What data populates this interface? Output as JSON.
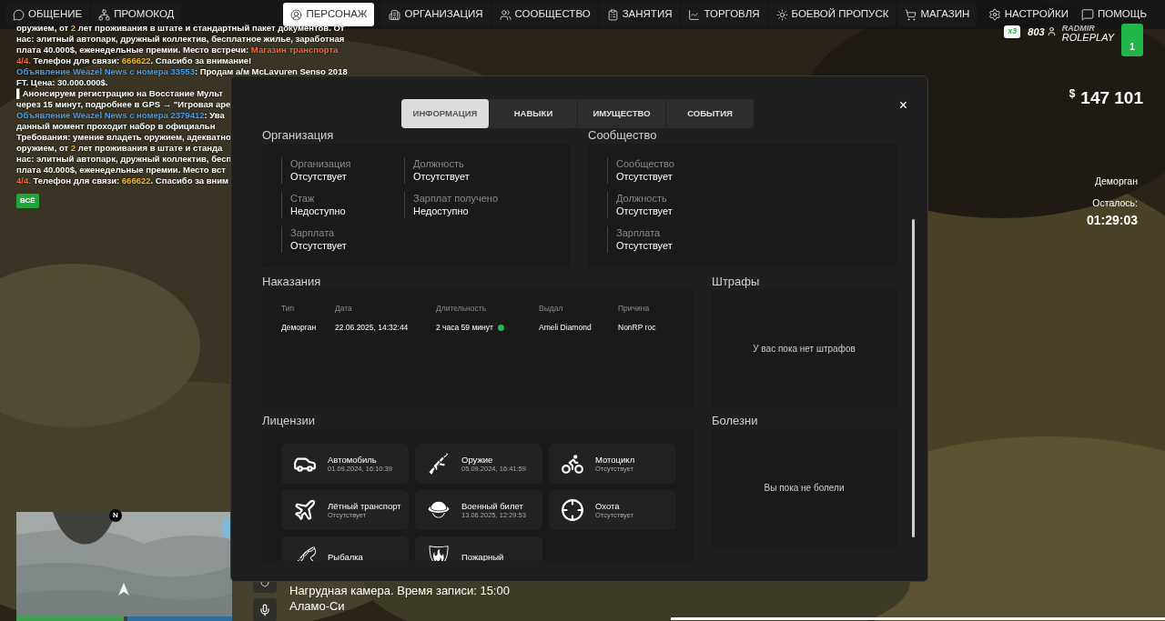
{
  "nav": {
    "left": [
      {
        "label": "ОБЩЕНИЕ",
        "selected": false
      },
      {
        "label": "ПРОМОКОД",
        "selected": false
      },
      {
        "label": "ПЕРСОНАЖ",
        "selected": true
      },
      {
        "label": "ОРГАНИЗАЦИЯ",
        "selected": false
      },
      {
        "label": "СООБЩЕСТВО",
        "selected": false
      },
      {
        "label": "ЗАНЯТИЯ",
        "selected": false
      },
      {
        "label": "ТОРГОВЛЯ",
        "selected": false
      },
      {
        "label": "БОЕВОЙ ПРОПУСК",
        "selected": false
      },
      {
        "label": "МАГАЗИН",
        "selected": false
      }
    ],
    "right": [
      {
        "label": "НАСТРОЙКИ",
        "selected": false
      },
      {
        "label": "ПОМОЩЬ",
        "selected": false
      }
    ]
  },
  "chat": {
    "lines": [
      [
        {
          "text": "оружием, от ",
          "color": "#ffffff"
        },
        {
          "text": "2",
          "color": "#f5b82e"
        },
        {
          "text": " лет проживания в штате и стандартный пакет документов. От",
          "color": "#ffffff"
        }
      ],
      [
        {
          "text": "нас: элитный автопарк, дружный коллектив, бесплатное жилье, заработная",
          "color": "#ffffff"
        }
      ],
      [
        {
          "text": "плата 40.000$, еженедельные премии. Место встречи: ",
          "color": "#ffffff"
        },
        {
          "text": "Магазин транспорта",
          "color": "#f06a3a"
        }
      ],
      [
        {
          "text": "4/4.",
          "color": "#f06a3a"
        },
        {
          "text": " Телефон для связи: ",
          "color": "#ffffff"
        },
        {
          "text": "666622",
          "color": "#f5b82e"
        },
        {
          "text": ". Спасибо за внимание!",
          "color": "#ffffff"
        }
      ],
      [
        {
          "text": "Объявление Weazel News с номера 33553",
          "color": "#4a9ee8"
        },
        {
          "text": ": Продам а/м McLavuren Senso 2018",
          "color": "#ffffff"
        }
      ],
      [
        {
          "text": "FT. Цена: 30.000.000$.",
          "color": "#ffffff"
        }
      ],
      [
        {
          "text": "▌Анонсируем регистрацию на Восстание Мульт",
          "color": "#ffffff"
        }
      ],
      [
        {
          "text": "через 15 минут, подробнее в GPS → \"Игровая аре",
          "color": "#ffffff"
        }
      ],
      [
        {
          "text": "Объявление Weazel News с номера 2379412",
          "color": "#4a9ee8"
        },
        {
          "text": ": Ува",
          "color": "#ffffff"
        }
      ],
      [
        {
          "text": "данный момент проходит набор в официальн",
          "color": "#ffffff"
        }
      ],
      [
        {
          "text": "Требования: умение владеть оружием, адекватно",
          "color": "#ffffff"
        }
      ],
      [
        {
          "text": "оружием, от ",
          "color": "#ffffff"
        },
        {
          "text": "2",
          "color": "#f5b82e"
        },
        {
          "text": " лет проживания в штате и станда",
          "color": "#ffffff"
        }
      ],
      [
        {
          "text": "нас: элитный автопарк, дружный коллектив, бесп",
          "color": "#ffffff"
        }
      ],
      [
        {
          "text": "плата 40.000$, еженедельные премии. Место вст",
          "color": "#ffffff"
        }
      ],
      [
        {
          "text": "4/4.",
          "color": "#f06a3a"
        },
        {
          "text": " Телефон для связи: ",
          "color": "#ffffff"
        },
        {
          "text": "666622",
          "color": "#f5b82e"
        },
        {
          "text": ". Спасибо за вним",
          "color": "#ffffff"
        }
      ]
    ],
    "filter": "ВСЁ"
  },
  "hud": {
    "multiplier": "x3",
    "online": "803",
    "logo_top": "RADMIR",
    "logo_bottom": "ROLEPLAY",
    "logo_badge": "1",
    "currency": "$",
    "money": "147 101",
    "jail": "Деморган",
    "remaining_label": "Осталось:",
    "remaining": "01:29:03"
  },
  "modal": {
    "tabs": [
      {
        "label": "ИНФОРМАЦИЯ",
        "selected": true
      },
      {
        "label": "НАВЫКИ",
        "selected": false
      },
      {
        "label": "ИМУЩЕСТВО",
        "selected": false
      },
      {
        "label": "СОБЫТИЯ",
        "selected": false
      }
    ],
    "close": "×",
    "organization": {
      "title": "Организация",
      "fields": [
        {
          "label": "Организация",
          "value": "Отсутствует"
        },
        {
          "label": "Должность",
          "value": "Отсутствует"
        },
        {
          "label": "Стаж",
          "value": "Недоступно"
        },
        {
          "label": "Зарплат получено",
          "value": "Недоступно"
        },
        {
          "label": "Зарплата",
          "value": "Отсутствует"
        }
      ]
    },
    "community": {
      "title": "Сообщество",
      "fields": [
        {
          "label": "Сообщество",
          "value": "Отсутствует"
        },
        {
          "label": "Должность",
          "value": "Отсутствует"
        },
        {
          "label": "Зарплата",
          "value": "Отсутствует"
        }
      ]
    },
    "punishments": {
      "title": "Наказания",
      "columns": [
        "Тип",
        "Дата",
        "Длительность",
        "Выдал",
        "Причина"
      ],
      "rows": [
        {
          "type": "Деморган",
          "date": "22.06.2025, 14:32:44",
          "duration": "2 часа 59 минут",
          "color": "#1fb84a",
          "issuer": "Ameli Diamond",
          "reason": "NonRP гос"
        }
      ]
    },
    "fines": {
      "title": "Штрафы",
      "empty": "У вас пока нет штрафов"
    },
    "licenses": {
      "title": "Лицензии",
      "items": [
        {
          "name": "Автомобиль",
          "sub": "01.09.2024, 16:10:39"
        },
        {
          "name": "Оружие",
          "sub": "05.09.2024, 16:41:59"
        },
        {
          "name": "Мотоцикл",
          "sub": "Отсутствует"
        },
        {
          "name": "Лётный транспорт",
          "sub": "Отсутствует"
        },
        {
          "name": "Военный билет",
          "sub": "13.06.2025, 12:29:53"
        },
        {
          "name": "Охота",
          "sub": "Отсутствует"
        },
        {
          "name": "Рыбалка"
        },
        {
          "name": "Пожарный"
        }
      ]
    },
    "diseases": {
      "title": "Болезни",
      "empty": "Вы пока не болели"
    }
  },
  "map": {
    "compass": "N"
  },
  "hud_bars": [
    {
      "color": "#3fa34d"
    },
    {
      "color": "#2f6f9f"
    }
  ],
  "bodycam": {
    "text": "Нагрудная камера. Время записи: 15:00",
    "location": "Аламо-Си"
  }
}
